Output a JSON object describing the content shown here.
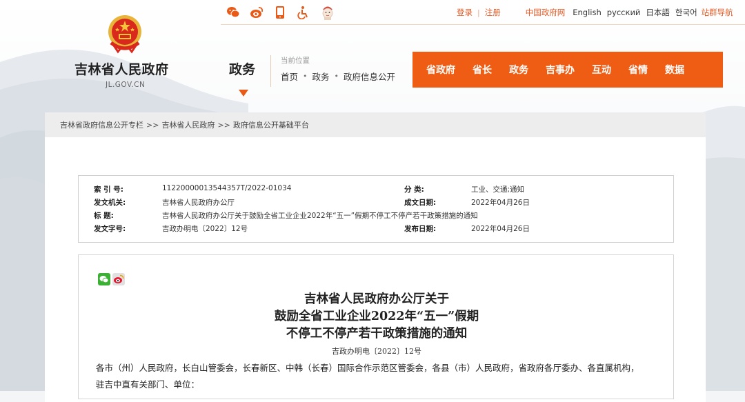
{
  "top_links": {
    "login": "登录",
    "register": "注册",
    "cn_gov": "中国政府网",
    "english": "English",
    "russian": "русский",
    "japanese": "日本語",
    "korean": "한국어",
    "site_nav": "站群导航"
  },
  "header": {
    "site_title": "吉林省人民政府",
    "domain": "JL.GOV.CN",
    "section": "政务",
    "location_label": "当前位置",
    "location_crumbs": [
      "首页",
      "政务",
      "政府信息公开"
    ]
  },
  "main_nav": [
    "省政府",
    "省长",
    "政务",
    "吉事办",
    "互动",
    "省情",
    "数据"
  ],
  "breadcrumb": [
    "吉林省政府信息公开专栏",
    "吉林省人民政府",
    "政府信息公开基础平台"
  ],
  "breadcrumb_sep": ">>",
  "meta": {
    "index_key": "索 引 号:",
    "index_val": "11220000013544357T/2022-01034",
    "category_key": "分 类:",
    "category_val": "工业、交通;通知",
    "issuer_key": "发文机关:",
    "issuer_val": "吉林省人民政府办公厅",
    "date_key": "成文日期:",
    "date_val": "2022年04月26日",
    "title_key": "标 题:",
    "title_val": "吉林省人民政府办公厅关于鼓励全省工业企业2022年“五一”假期不停工不停产若干政策措施的通知",
    "docno_key": "发文字号:",
    "docno_val": "吉政办明电〔2022〕12号",
    "publish_key": "发布日期:",
    "publish_val": "2022年04月26日"
  },
  "article": {
    "title_line1": "吉林省人民政府办公厅关于",
    "title_line2": "鼓励全省工业企业2022年“五一”假期",
    "title_line3": "不停工不停产若干政策措施的通知",
    "doc_number": "吉政办明电〔2022〕12号",
    "body_line1": "各市（州）人民政府，长白山管委会，长春新区、中韩（长春）国际合作示范区管委会，各县（市）人民政府，省政府各厅委办、各直属机构，",
    "body_line2": "驻吉中直有关部门、单位："
  },
  "colors": {
    "accent": "#ef5d14",
    "link_orange": "#e45a25"
  },
  "icons": [
    "weixin-icon",
    "weibo-icon",
    "mobile-icon",
    "accessibility-icon",
    "mascot-icon",
    "emblem-icon"
  ]
}
